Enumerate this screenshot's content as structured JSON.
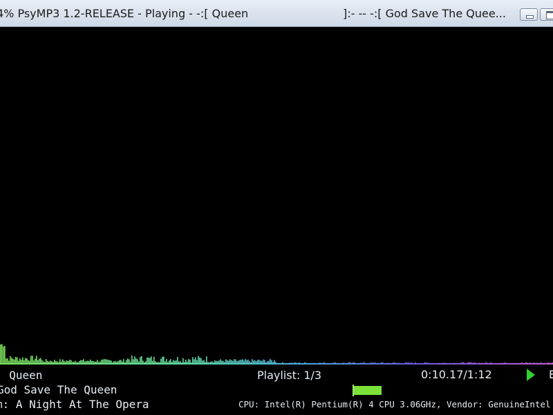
{
  "window": {
    "title": "4% PsyMP3 1.2-RELEASE - Playing - -:[ Queen",
    "title_right": "]:- -- -:[ God Save The Quee...",
    "minimize_icon": "minimize-icon",
    "maximize_icon": "maximize-icon"
  },
  "track": {
    "artist_line": ": Queen",
    "title_line": "God Save The Queen",
    "album_line": "m: A Night At The Opera",
    "playlist": "Playlist: 1/3",
    "time": "0:10.17/1:12",
    "truncated_label": "E"
  },
  "system": {
    "cpu": "CPU: Intel(R) Pentium(R) 4 CPU 3.06GHz, Vendor: GenuineIntel"
  },
  "controls": {
    "play_icon": "play-icon",
    "volume_fraction": 0.95
  },
  "colors": {
    "background": "#000000",
    "text": "#e6ecf2",
    "play": "#2fd02f",
    "volume": "#7ce23a",
    "spectrum_low": "#7be05a",
    "spectrum_mid": "#4aa9e0",
    "spectrum_high": "#c060d0"
  }
}
